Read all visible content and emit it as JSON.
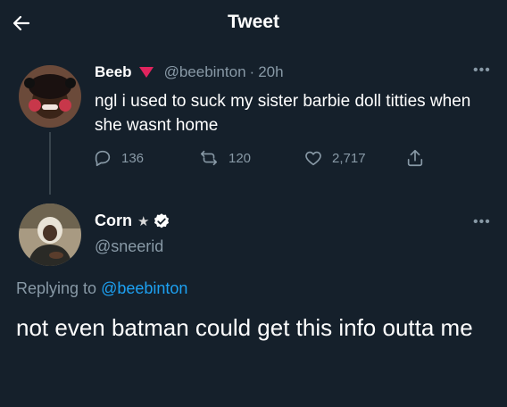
{
  "header": {
    "title": "Tweet"
  },
  "parent_tweet": {
    "author_name": "Beeb",
    "handle": "@beebinton",
    "separator": "·",
    "time": "20h",
    "text": "ngl i used to suck my sister barbie doll titties when she wasnt home",
    "replies": "136",
    "retweets": "120",
    "likes": "2,717"
  },
  "reply_tweet": {
    "author_name": "Corn",
    "handle": "@sneerid",
    "replying_prefix": "Replying to",
    "replying_handle": "@beebinton",
    "text": "not even batman could get this info outta me"
  },
  "colors": {
    "background": "#15202b",
    "muted": "#8899a6",
    "accent": "#1da1f2",
    "emoji_red": "#e0245e"
  }
}
